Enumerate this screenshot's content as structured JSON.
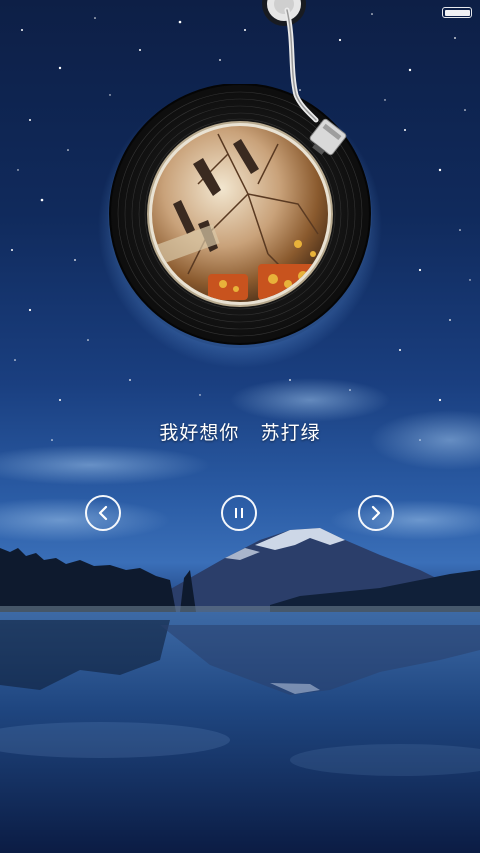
{
  "player": {
    "song_title": "我好想你",
    "artist": "苏打绿",
    "prev_icon": "chevron-left-icon",
    "pause_icon": "pause-icon",
    "next_icon": "chevron-right-icon"
  },
  "status_bar": {
    "battery_icon": "battery-icon",
    "battery_level": 1.0
  },
  "colors": {
    "sky_top": "#0d1f46",
    "sky_horizon": "#3a6fb8",
    "control_stroke": "#ffffff",
    "vinyl": "#1a1a1a"
  }
}
